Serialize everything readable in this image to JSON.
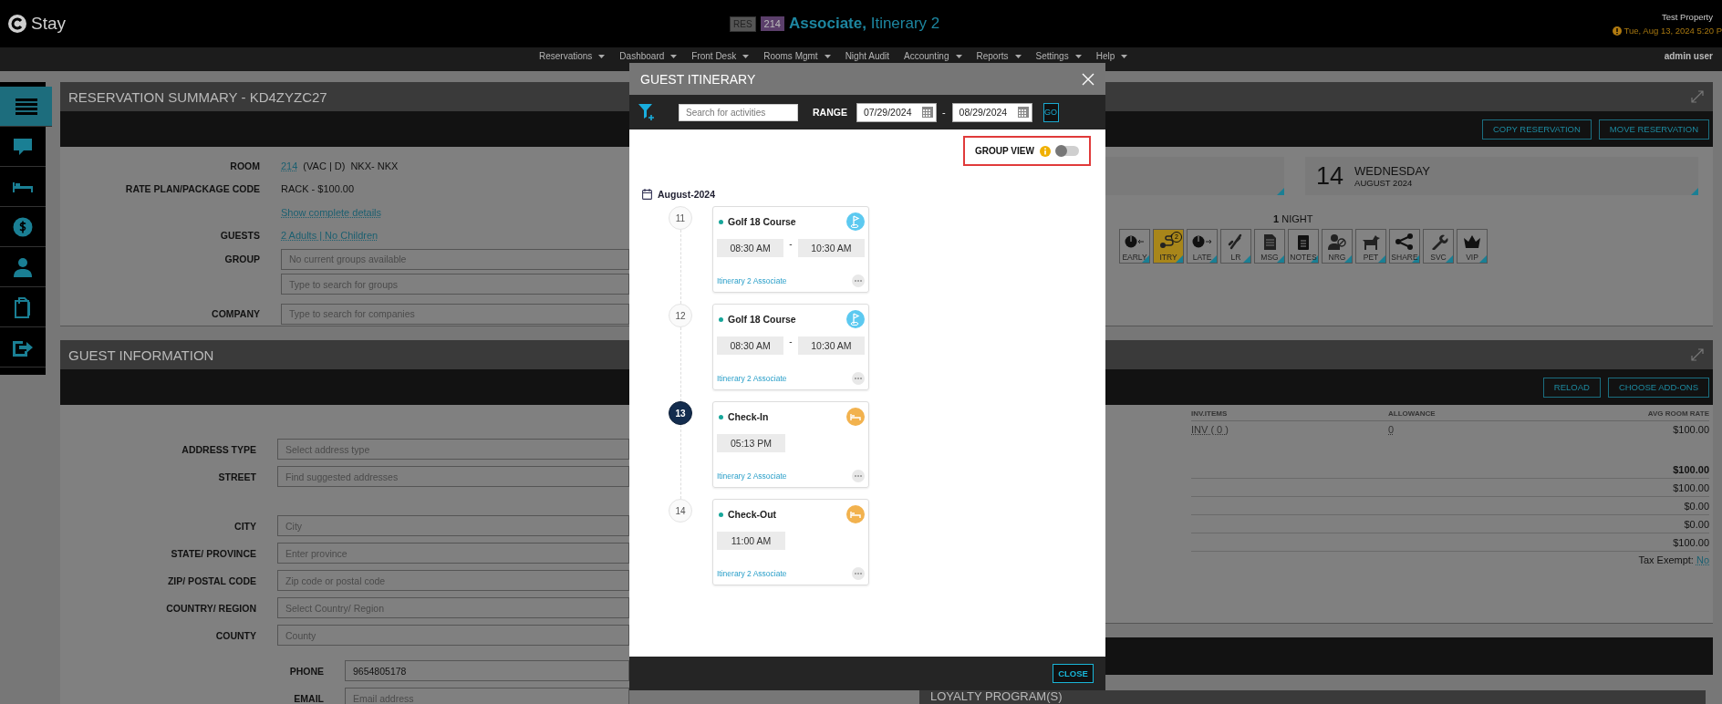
{
  "header": {
    "logo_text": "Stay",
    "res_badge": "RES",
    "room_badge": "214",
    "guest_name": "Associate,",
    "itinerary_name": "Itinerary 2",
    "property": "Test Property",
    "datetime": "Tue, Aug 13, 2024 5:20 P"
  },
  "menu": {
    "items": [
      {
        "label": "Reservations",
        "caret": true
      },
      {
        "label": "Dashboard",
        "caret": true
      },
      {
        "label": "Front Desk",
        "caret": true
      },
      {
        "label": "Rooms Mgmt",
        "caret": true
      },
      {
        "label": "Night Audit",
        "caret": false
      },
      {
        "label": "Accounting",
        "caret": true
      },
      {
        "label": "Reports",
        "caret": true
      },
      {
        "label": "Settings",
        "caret": true
      },
      {
        "label": "Help",
        "caret": true
      }
    ],
    "user": "admin user"
  },
  "sidebar": {
    "items": [
      {
        "kind": "menu",
        "selected": true
      },
      {
        "kind": "chat",
        "selected": false
      },
      {
        "kind": "bed",
        "selected": false
      },
      {
        "kind": "dollar",
        "selected": false
      },
      {
        "kind": "person",
        "selected": false
      },
      {
        "kind": "clipboard",
        "selected": false
      },
      {
        "kind": "export",
        "selected": false
      }
    ]
  },
  "reservation_summary": {
    "title": "RESERVATION SUMMARY - KD4ZYZC27",
    "buttons": [
      "COPY RESERVATION",
      "MOVE RESERVATION"
    ],
    "room": {
      "label": "ROOM",
      "number": "214",
      "status": "(VAC | D)",
      "type": "NKX- NKX"
    },
    "rate_plan": {
      "label": "RATE PLAN/PACKAGE CODE",
      "value": "RACK - $100.00",
      "details_link": "Show complete details"
    },
    "guests": {
      "label": "GUESTS",
      "value": "2 Adults | No Children"
    },
    "group": {
      "label": "GROUP",
      "placeholders": [
        "No current groups available",
        "Type to search for groups"
      ]
    },
    "company": {
      "label": "COMPANY",
      "placeholder": "Type to search for companies"
    },
    "departure": {
      "day": "14",
      "weekday": "WEDNESDAY",
      "month": "AUGUST 2024"
    },
    "nights": {
      "count": "1",
      "label": "NIGHT"
    },
    "flags": [
      {
        "label": "EARLY",
        "kind": "clock-left",
        "selected": false
      },
      {
        "label": "ITRY",
        "kind": "route",
        "selected": true,
        "badge": "2"
      },
      {
        "label": "LATE",
        "kind": "clock-right",
        "selected": false
      },
      {
        "label": "LR",
        "kind": "link",
        "selected": false
      },
      {
        "label": "MSG",
        "kind": "document",
        "selected": false
      },
      {
        "label": "NOTES",
        "kind": "clipboard",
        "selected": false
      },
      {
        "label": "NRG",
        "kind": "person-no",
        "selected": false
      },
      {
        "label": "PET",
        "kind": "dog",
        "selected": false
      },
      {
        "label": "SHARE",
        "kind": "share",
        "selected": false
      },
      {
        "label": "SVC",
        "kind": "wrench",
        "selected": false
      },
      {
        "label": "VIP",
        "kind": "crown",
        "selected": false
      }
    ]
  },
  "guest_information": {
    "title": "GUEST INFORMATION",
    "buttons": [
      "RELOAD",
      "CHOOSE ADD-ONS"
    ],
    "address_fields": [
      {
        "label": "ADDRESS TYPE",
        "placeholder": "Select address type"
      },
      {
        "label": "STREET",
        "placeholder": "Find suggested addresses"
      },
      {
        "label": "CITY",
        "placeholder": "City"
      },
      {
        "label": "STATE/ PROVINCE",
        "placeholder": "Enter province"
      },
      {
        "label": "ZIP/ POSTAL CODE",
        "placeholder": "Zip code or postal code"
      },
      {
        "label": "COUNTRY/ REGION",
        "placeholder": "Select Country/ Region"
      },
      {
        "label": "COUNTY",
        "placeholder": "County"
      }
    ],
    "contact_fields": [
      {
        "label": "PHONE",
        "value": "9654805178"
      },
      {
        "label": "EMAIL",
        "placeholder": "Email address"
      }
    ],
    "addons": {
      "columns": [
        "INV.ITEMS",
        "ALLOWANCE",
        "AVG ROOM RATE"
      ],
      "row": {
        "inv_items": "INV ( 0 )",
        "allowance": "0",
        "avg_room_rate": "$100.00"
      },
      "totals": [
        {
          "value": "$100.00",
          "bold": true
        },
        {
          "value": "$100.00",
          "bold": false
        },
        {
          "value": "$0.00",
          "bold": false
        },
        {
          "value": "$0.00",
          "bold": false
        },
        {
          "value": "$100.00",
          "bold": false
        }
      ],
      "tax_exempt": {
        "label": "Tax Exempt:",
        "value": "No"
      }
    }
  },
  "loyalty": {
    "title": "LOYALTY PROGRAM(S)"
  },
  "itinerary_dialog": {
    "title": "GUEST ITINERARY",
    "search_placeholder": "Search for activities",
    "range_label": "RANGE",
    "date_from": "07/29/2024",
    "range_separator": "-",
    "date_to": "08/29/2024",
    "go_button": "GO",
    "group_view": {
      "label": "GROUP VIEW",
      "on": false
    },
    "month": "August-2024",
    "time_separator": "-",
    "entries": [
      {
        "day": "11",
        "selected": false,
        "title": "Golf 18 Course",
        "kind": "golf",
        "times": [
          "08:30 AM",
          "10:30 AM"
        ],
        "guest": "Itinerary 2 Associate"
      },
      {
        "day": "12",
        "selected": false,
        "title": "Golf 18 Course",
        "kind": "golf",
        "times": [
          "08:30 AM",
          "10:30 AM"
        ],
        "guest": "Itinerary 2 Associate"
      },
      {
        "day": "13",
        "selected": true,
        "title": "Check-In",
        "kind": "bed",
        "times": [
          "05:13 PM"
        ],
        "guest": "Itinerary 2 Associate"
      },
      {
        "day": "14",
        "selected": false,
        "title": "Check-Out",
        "kind": "bed",
        "times": [
          "11:00 AM"
        ],
        "guest": "Itinerary 2 Associate"
      }
    ],
    "close_button": "CLOSE"
  }
}
